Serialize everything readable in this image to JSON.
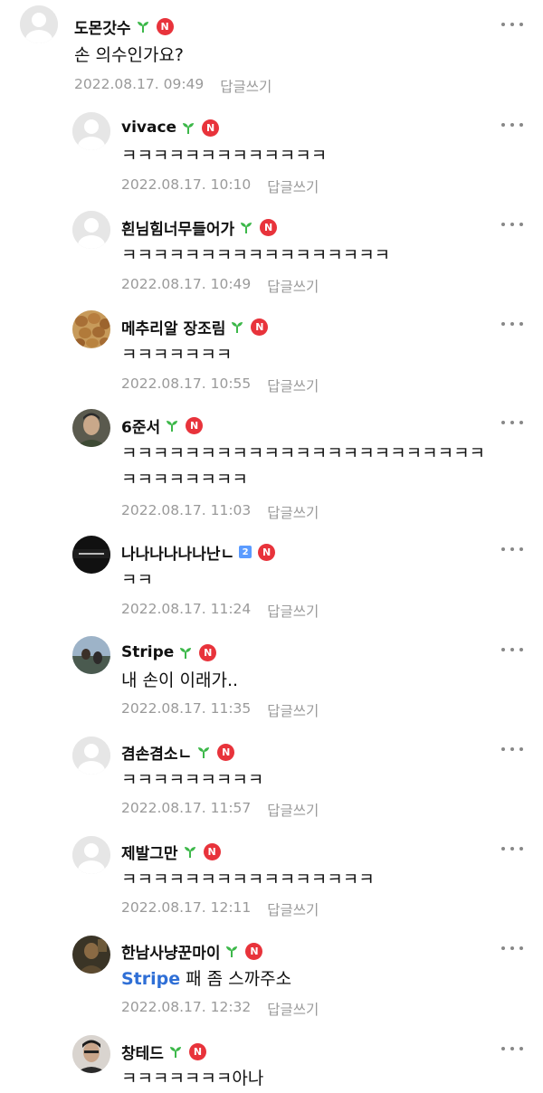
{
  "comments": [
    {
      "nick": "도몬갓수",
      "text": "손 의수인가요?",
      "date": "2022.08.17. 09:49",
      "reply": "답글쓰기"
    },
    {
      "nick": "vivace",
      "text": "ㅋㅋㅋㅋㅋㅋㅋㅋㅋㅋㅋㅋㅋ",
      "date": "2022.08.17. 10:10",
      "reply": "답글쓰기"
    },
    {
      "nick": "흰님힘너무들어가",
      "text": "ㅋㅋㅋㅋㅋㅋㅋㅋㅋㅋㅋㅋㅋㅋㅋㅋㅋ",
      "date": "2022.08.17. 10:49",
      "reply": "답글쓰기"
    },
    {
      "nick": "메추리알 장조림",
      "text": "ㅋㅋㅋㅋㅋㅋㅋ",
      "date": "2022.08.17. 10:55",
      "reply": "답글쓰기"
    },
    {
      "nick": "6준서",
      "text": "ㅋㅋㅋㅋㅋㅋㅋㅋㅋㅋㅋㅋㅋㅋㅋㅋㅋㅋㅋㅋㅋㅋㅋ",
      "text2": "ㅋㅋㅋㅋㅋㅋㅋㅋ",
      "date": "2022.08.17. 11:03",
      "reply": "답글쓰기"
    },
    {
      "nick": "나나나나나나난ㄴ",
      "level": "2",
      "text": "ㅋㅋ",
      "date": "2022.08.17. 11:24",
      "reply": "답글쓰기"
    },
    {
      "nick": "Stripe",
      "text": "내 손이 이래가..",
      "date": "2022.08.17. 11:35",
      "reply": "답글쓰기"
    },
    {
      "nick": "겸손겸소ㄴ",
      "text": "ㅋㅋㅋㅋㅋㅋㅋㅋㅋ",
      "date": "2022.08.17. 11:57",
      "reply": "답글쓰기"
    },
    {
      "nick": "제발그만",
      "text": "ㅋㅋㅋㅋㅋㅋㅋㅋㅋㅋㅋㅋㅋㅋㅋㅋ",
      "date": "2022.08.17. 12:11",
      "reply": "답글쓰기"
    },
    {
      "nick": "한남사냥꾼마이",
      "mention": "Stripe",
      "text": "패 좀 스까주소",
      "date": "2022.08.17. 12:32",
      "reply": "답글쓰기"
    },
    {
      "nick": "창테드",
      "text": "ㅋㅋㅋㅋㅋㅋㅋ아나"
    }
  ],
  "badge_letter": "N",
  "colors": {
    "badge": "#e8333b",
    "sprout": "#3db84a",
    "mention": "#2f6fd6",
    "meta": "#9a9a9a"
  }
}
